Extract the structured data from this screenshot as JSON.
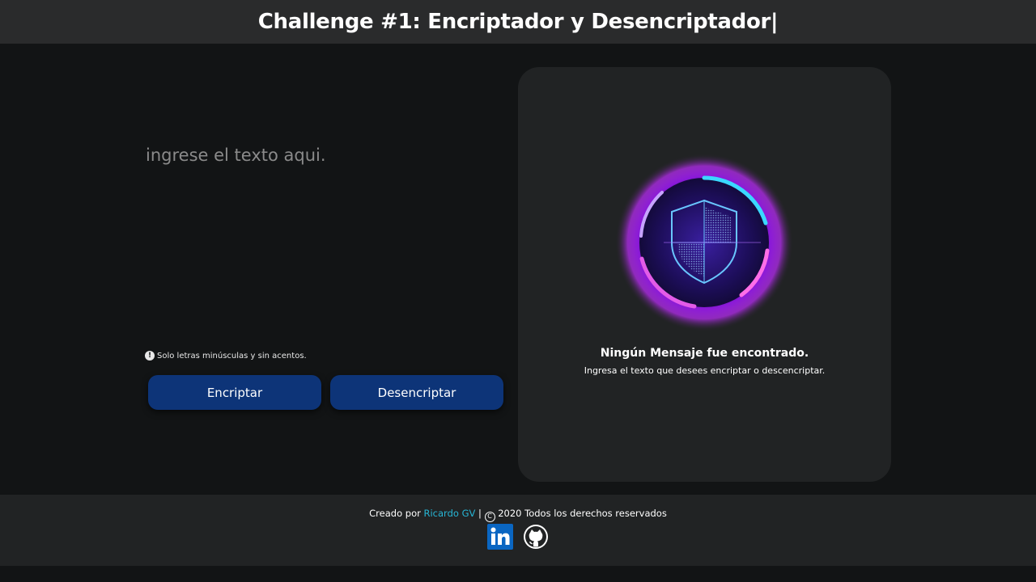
{
  "header": {
    "title": "Challenge #1: Encriptador y Desencriptador|"
  },
  "input": {
    "placeholder": "ingrese el texto aqui.",
    "value": ""
  },
  "hint": {
    "icon": "info-icon",
    "text": "Solo letras minúsculas y sin acentos."
  },
  "buttons": {
    "encrypt_label": "Encriptar",
    "decrypt_label": "Desencriptar"
  },
  "result": {
    "image": "security-shield-emblem",
    "title": "Ningún Mensaje fue encontrado.",
    "subtitle": "Ingresa el texto que desees encriptar o descencriptar."
  },
  "footer": {
    "prefix": "Creado por ",
    "author": "Ricardo GV",
    "separator": " | ",
    "copyright_symbol": "C",
    "rights": " 2020 Todos los derechos reservados",
    "social": [
      "linkedin-icon",
      "github-icon"
    ]
  },
  "colors": {
    "background": "#121415",
    "header": "#2a2b2c",
    "panel": "#212324",
    "button": "#0d3478",
    "accent": "#27b6d6"
  }
}
